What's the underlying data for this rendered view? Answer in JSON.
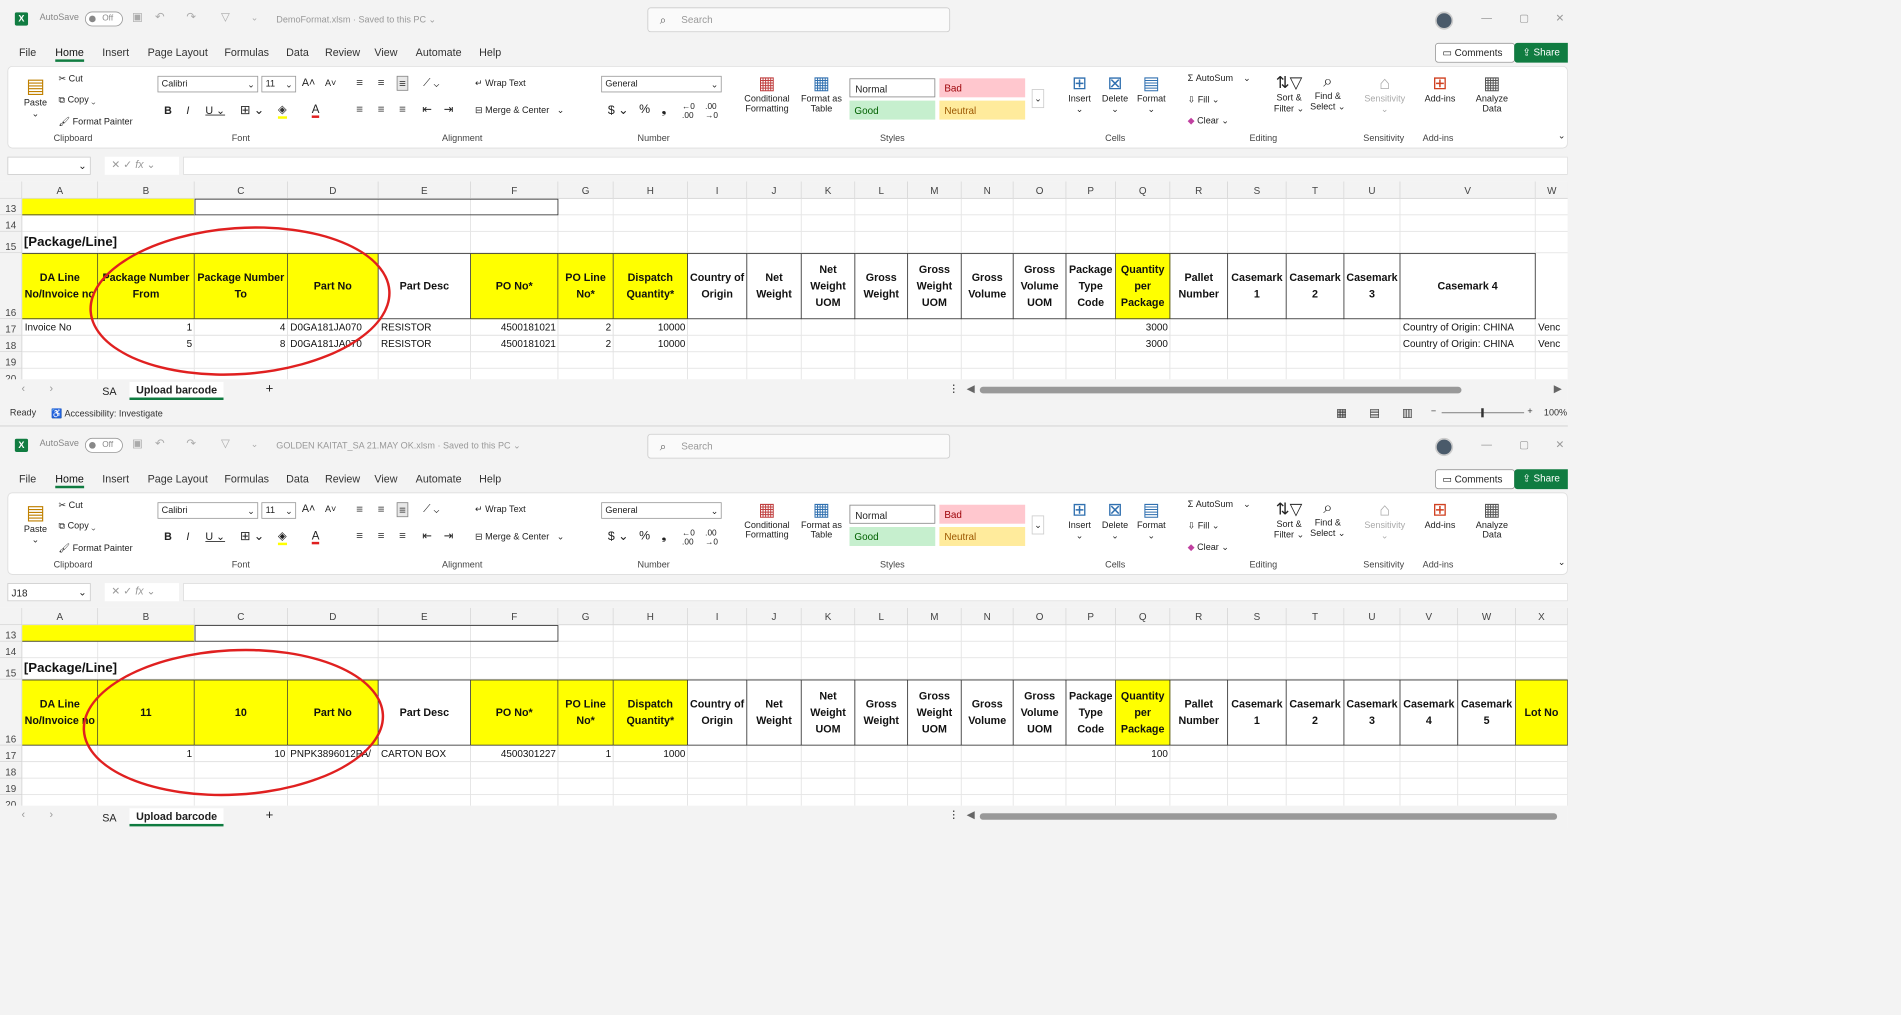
{
  "windows": [
    {
      "title": "DemoFormat.xlsm",
      "saved": "Saved to this PC",
      "name_box": "",
      "header_b": "Package Number From",
      "header_c": "Package Number To",
      "rows": [
        {
          "row": "17",
          "a": "Invoice No",
          "b": "1",
          "c": "4",
          "d": "D0GA181JA070",
          "e": "RESISTOR",
          "f": "4500181021",
          "g": "2",
          "h": "10000",
          "q": "3000",
          "v": "Country of Origin: CHINA",
          "w": "Venc"
        },
        {
          "row": "18",
          "a": "",
          "b": "5",
          "c": "8",
          "d": "D0GA181JA070",
          "e": "RESISTOR",
          "f": "4500181021",
          "g": "2",
          "h": "10000",
          "q": "3000",
          "v": "Country of Origin: CHINA",
          "w": "Venc"
        }
      ],
      "status": {
        "ready": "Ready",
        "accessibility": "Accessibility: Investigate",
        "zoom": "100%"
      }
    },
    {
      "title": "GOLDEN KAITAT_SA 21.MAY OK.xlsm",
      "saved": "Saved to this PC",
      "name_box": "J18",
      "header_b": "11",
      "header_c": "10",
      "rows": [
        {
          "row": "17",
          "a": "",
          "b": "1",
          "c": "10",
          "d": "PNPK3896012PA/",
          "e": "CARTON BOX",
          "f": "4500301227",
          "g": "1",
          "h": "1000",
          "q": "100"
        }
      ]
    }
  ],
  "common": {
    "autosave": "AutoSave",
    "off": "Off",
    "search": "Search",
    "menu": [
      "File",
      "Home",
      "Insert",
      "Page Layout",
      "Formulas",
      "Data",
      "Review",
      "View",
      "Automate",
      "Help"
    ],
    "comments": "Comments",
    "share": "Share",
    "clipboard": {
      "paste": "Paste",
      "cut": "Cut",
      "copy": "Copy",
      "format_painter": "Format Painter",
      "label": "Clipboard"
    },
    "font": {
      "name": "Calibri",
      "size": "11",
      "label": "Font"
    },
    "alignment": {
      "wrap": "Wrap Text",
      "merge": "Merge & Center",
      "label": "Alignment"
    },
    "number": {
      "format": "General",
      "label": "Number"
    },
    "styles": {
      "cf": "Conditional Formatting",
      "fat": "Format as Table",
      "normal": "Normal",
      "bad": "Bad",
      "good": "Good",
      "neutral": "Neutral",
      "label": "Styles"
    },
    "cells": {
      "insert": "Insert",
      "delete": "Delete",
      "format": "Format",
      "label": "Cells"
    },
    "editing": {
      "autosum": "AutoSum",
      "fill": "Fill",
      "clear": "Clear",
      "sort": "Sort & Filter",
      "find": "Find & Select",
      "label": "Editing"
    },
    "sensitivity": {
      "btn": "Sensitivity",
      "label": "Sensitivity"
    },
    "addins": {
      "btn": "Add-ins",
      "label": "Add-ins"
    },
    "analyze": "Analyze Data",
    "columns": [
      "A",
      "B",
      "C",
      "D",
      "E",
      "F",
      "G",
      "H",
      "I",
      "J",
      "K",
      "L",
      "M",
      "N",
      "O",
      "P",
      "Q",
      "R",
      "S",
      "T",
      "U",
      "V",
      "W",
      "X"
    ],
    "row_numbers": [
      "13",
      "14",
      "15",
      "16",
      "17",
      "18",
      "19",
      "20"
    ],
    "section_title": "[Package/Line]",
    "headers": {
      "a": "DA Line No/Invoice no",
      "d": "Part No",
      "e": "Part Desc",
      "f": "PO No*",
      "g": "PO Line No*",
      "h": "Dispatch Quantity*",
      "i": "Country of Origin",
      "j": "Net Weight",
      "k": "Net Weight UOM",
      "l": "Gross Weight",
      "m": "Gross Weight UOM",
      "n": "Gross Volume",
      "o": "Gross Volume UOM",
      "p": "Package Type Code",
      "q": "Quantity per Package",
      "r": "Pallet Number",
      "s": "Casemark 1",
      "t": "Casemark 2",
      "u": "Casemark 3",
      "v4": "Casemark 4",
      "w5": "Casemark 5",
      "x": "Lot No"
    },
    "tabs": {
      "sa": "SA",
      "upload": "Upload barcode"
    },
    "colors": {
      "accent": "#107c41",
      "header_yellow": "#ffff00",
      "annotation": "#e02020"
    }
  }
}
